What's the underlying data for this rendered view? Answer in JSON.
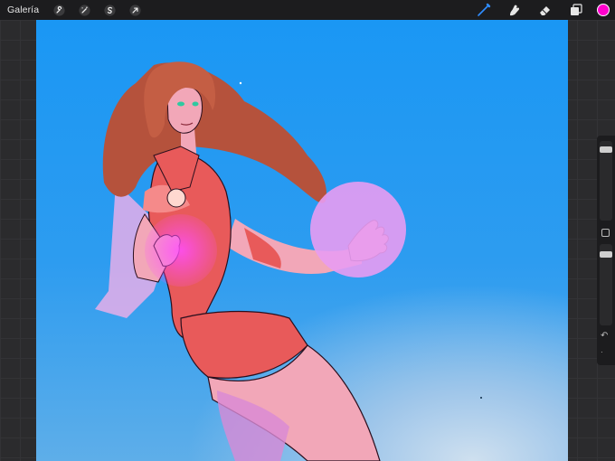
{
  "topbar": {
    "gallery_label": "Galería",
    "left_tools": [
      {
        "name": "wrench-icon"
      },
      {
        "name": "magic-wand-icon"
      },
      {
        "name": "selection-s-icon"
      },
      {
        "name": "transform-arrow-icon"
      }
    ],
    "right_tools": [
      {
        "name": "brush-icon",
        "active": true
      },
      {
        "name": "smudge-icon"
      },
      {
        "name": "eraser-icon"
      },
      {
        "name": "layers-icon"
      }
    ],
    "current_color": "#ff00cc",
    "active_tool_color": "#2f8cff"
  },
  "colors": {
    "toolbar_bg": "#1c1c1e",
    "workspace_bg": "#2b2b2d",
    "canvas_blue": "#1a97f4",
    "hair": "#b5523c",
    "suit_red": "#e85a5a",
    "skin": "#f2a7b8",
    "orb": "#e89cf2"
  },
  "sidebar": {
    "brush_size_level": 0.1,
    "opacity_level": 0.1
  }
}
